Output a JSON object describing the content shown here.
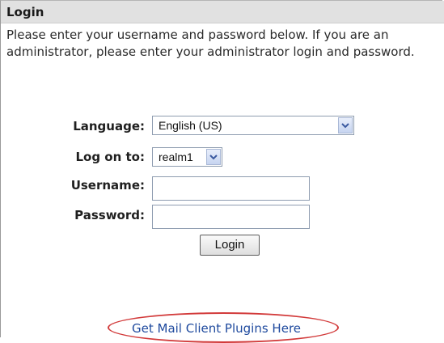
{
  "header": {
    "title": "Login"
  },
  "intro": {
    "text": "Please enter your username and password below. If you are an administrator, please enter your administrator login and password."
  },
  "form": {
    "language_label": "Language:",
    "language_value": "English (US)",
    "logon_label": "Log on to:",
    "logon_value": "realm1",
    "username_label": "Username:",
    "username_value": "",
    "password_label": "Password:",
    "password_value": "",
    "login_button": "Login"
  },
  "footer": {
    "plugin_link": "Get Mail Client Plugins Here"
  },
  "colors": {
    "header_bg": "#e1e1e1",
    "link": "#1f4a9e",
    "highlight_oval": "#d23a3a"
  }
}
